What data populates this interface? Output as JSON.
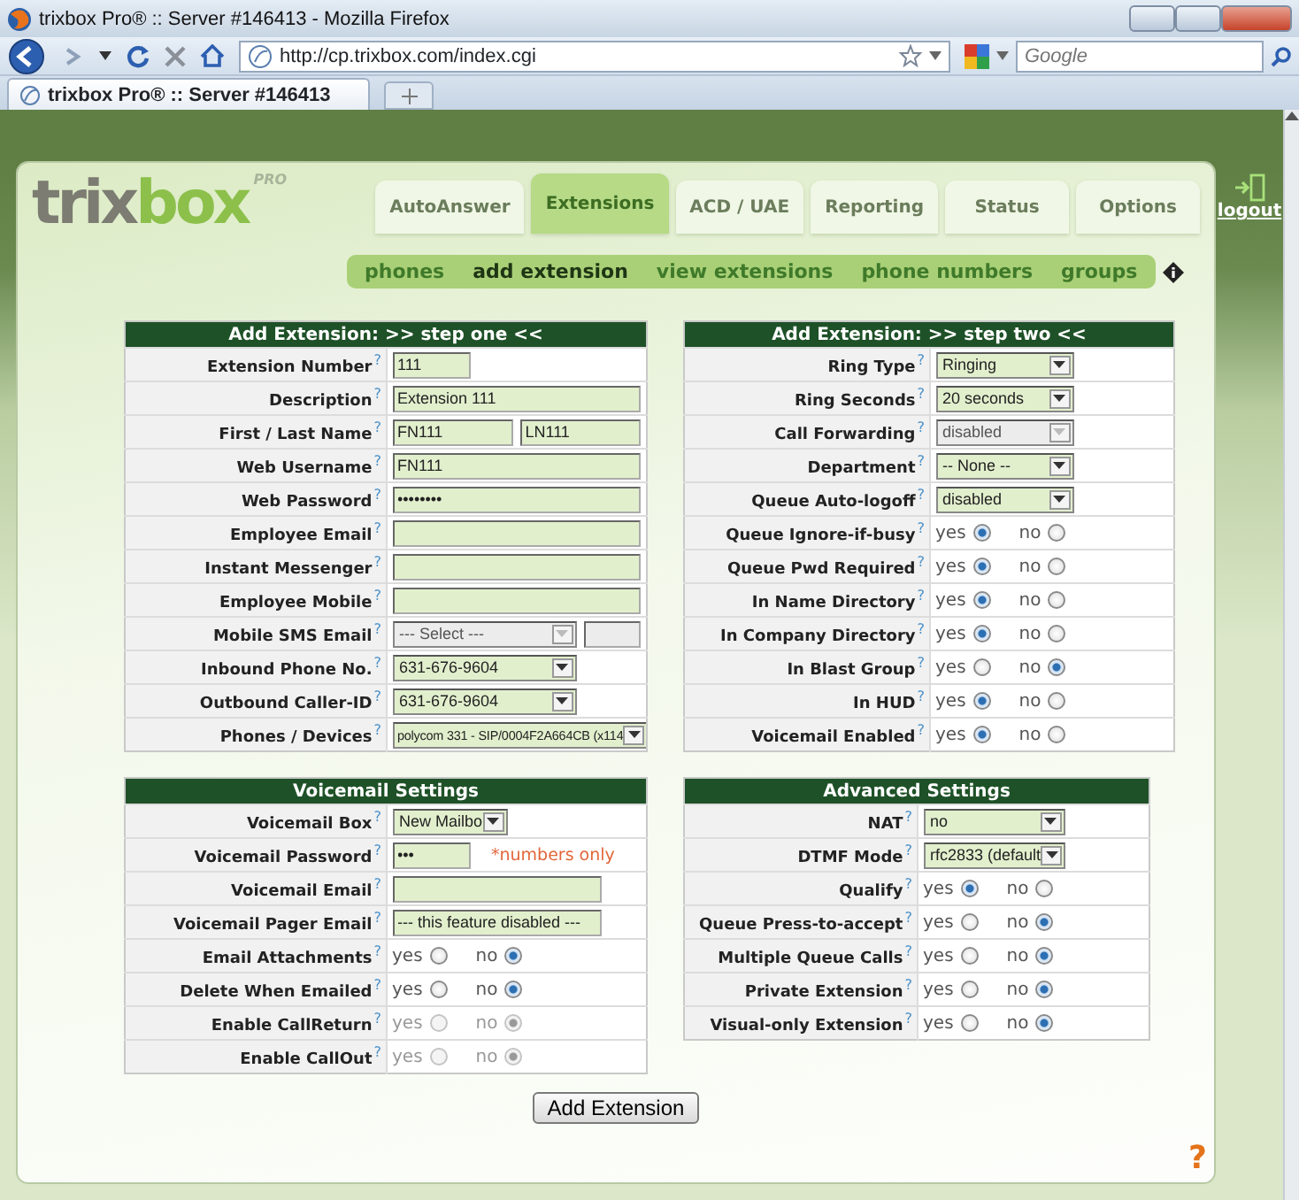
{
  "browser": {
    "title": "trixbox Pro® :: Server #146413 - Mozilla Firefox",
    "url": "http://cp.trixbox.com/index.cgi",
    "search_placeholder": "Google",
    "tabs": [
      {
        "label": "trixbox Pro® :: Server #146413",
        "selected": true
      }
    ]
  },
  "app": {
    "logo": {
      "primary": "trix",
      "accent": "box",
      "tag": "PRO"
    },
    "nav": [
      {
        "label": "AutoAnswer",
        "selected": false
      },
      {
        "label": "Extensions",
        "selected": true
      },
      {
        "label": "ACD / UAE",
        "selected": false
      },
      {
        "label": "Reporting",
        "selected": false
      },
      {
        "label": "Status",
        "selected": false
      },
      {
        "label": "Options",
        "selected": false
      }
    ],
    "subnav": [
      {
        "label": "phones",
        "selected": false
      },
      {
        "label": "add extension",
        "selected": true
      },
      {
        "label": "view extensions",
        "selected": false
      },
      {
        "label": "phone numbers",
        "selected": false
      },
      {
        "label": "groups",
        "selected": false
      }
    ],
    "logout": "logout",
    "panels": [
      {
        "title": "Add Extension: >> step one <<",
        "rows": [
          {
            "label": "Extension Number",
            "help": "?",
            "fields": [
              {
                "kind": "short_input",
                "value": "111"
              }
            ]
          },
          {
            "label": "Description",
            "help": "?",
            "fields": [
              {
                "kind": "input",
                "value": "Extension 111"
              }
            ]
          },
          {
            "label": "First / Last Name",
            "help": "?",
            "fields": [
              {
                "kind": "input",
                "value": "FN111"
              },
              {
                "kind": "input",
                "value": "LN111"
              }
            ]
          },
          {
            "label": "Web Username",
            "help": "?",
            "fields": [
              {
                "kind": "input",
                "value": "FN111"
              }
            ]
          },
          {
            "label": "Web Password",
            "help": "?",
            "fields": [
              {
                "kind": "input",
                "value": "••••••••"
              }
            ]
          },
          {
            "label": "Employee Email",
            "help": "?",
            "fields": [
              {
                "kind": "input"
              }
            ]
          },
          {
            "label": "Instant Messenger",
            "help": "?",
            "fields": [
              {
                "kind": "input"
              }
            ]
          },
          {
            "label": "Employee Mobile",
            "help": "?",
            "fields": [
              {
                "kind": "input"
              }
            ]
          },
          {
            "label": "Mobile SMS Email",
            "help": "?",
            "fields": [
              {
                "kind": "select",
                "value": "--- Select ---",
                "disabled": true
              },
              {
                "kind": "input",
                "disabled": true
              }
            ]
          },
          {
            "label": "Inbound Phone No.",
            "help": "?",
            "fields": [
              {
                "kind": "select",
                "value": "631-676-9604",
                "disabled": false
              }
            ]
          },
          {
            "label": "Outbound Caller-ID",
            "help": "?",
            "fields": [
              {
                "kind": "select",
                "value": "631-676-9604",
                "disabled": false
              }
            ]
          },
          {
            "label": "Phones / Devices",
            "help": "?",
            "fields": [
              {
                "kind": "wide_select",
                "value": "polycom 331 - SIP/0004F2A664CB  (x114",
                "disabled": false
              }
            ]
          }
        ]
      },
      {
        "title": "Add Extension: >> step two <<",
        "rows": [
          {
            "label": "Ring Type",
            "help": "?",
            "fields": [
              {
                "kind": "select",
                "value": "Ringing",
                "disabled": false
              }
            ]
          },
          {
            "label": "Ring Seconds",
            "help": "?",
            "fields": [
              {
                "kind": "select",
                "value": "20 seconds",
                "disabled": false
              }
            ]
          },
          {
            "label": "Call Forwarding",
            "help": "?",
            "fields": [
              {
                "kind": "select",
                "value": "disabled",
                "disabled": true
              }
            ]
          },
          {
            "label": "Department",
            "help": "?",
            "fields": [
              {
                "kind": "select",
                "value": "-- None --",
                "disabled": false
              }
            ]
          },
          {
            "label": "Queue Auto-logoff",
            "help": "?",
            "fields": [
              {
                "kind": "select",
                "value": "disabled",
                "disabled": false
              }
            ]
          },
          {
            "label": "Queue Ignore-if-busy",
            "help": "?",
            "fields": [
              {
                "kind": "radio",
                "options": [
                  {
                    "label": "yes",
                    "selected": true,
                    "disabled": false
                  },
                  {
                    "label": "no",
                    "selected": false,
                    "disabled": false
                  }
                ]
              }
            ]
          },
          {
            "label": "Queue Pwd Required",
            "help": "?",
            "fields": [
              {
                "kind": "radio",
                "options": [
                  {
                    "label": "yes",
                    "selected": true,
                    "disabled": false
                  },
                  {
                    "label": "no",
                    "selected": false,
                    "disabled": false
                  }
                ]
              }
            ]
          },
          {
            "label": "In Name Directory",
            "help": "?",
            "fields": [
              {
                "kind": "radio",
                "options": [
                  {
                    "label": "yes",
                    "selected": true,
                    "disabled": false
                  },
                  {
                    "label": "no",
                    "selected": false,
                    "disabled": false
                  }
                ]
              }
            ]
          },
          {
            "label": "In Company Directory",
            "help": "?",
            "fields": [
              {
                "kind": "radio",
                "options": [
                  {
                    "label": "yes",
                    "selected": true,
                    "disabled": false
                  },
                  {
                    "label": "no",
                    "selected": false,
                    "disabled": false
                  }
                ]
              }
            ]
          },
          {
            "label": "In Blast Group",
            "help": "?",
            "fields": [
              {
                "kind": "radio",
                "options": [
                  {
                    "label": "yes",
                    "selected": false,
                    "disabled": false
                  },
                  {
                    "label": "no",
                    "selected": true,
                    "disabled": false
                  }
                ]
              }
            ]
          },
          {
            "label": "In HUD",
            "help": "?",
            "fields": [
              {
                "kind": "radio",
                "options": [
                  {
                    "label": "yes",
                    "selected": true,
                    "disabled": false
                  },
                  {
                    "label": "no",
                    "selected": false,
                    "disabled": false
                  }
                ]
              }
            ]
          },
          {
            "label": "Voicemail Enabled",
            "help": "?",
            "fields": [
              {
                "kind": "radio",
                "options": [
                  {
                    "label": "yes",
                    "selected": true,
                    "disabled": false
                  },
                  {
                    "label": "no",
                    "selected": false,
                    "disabled": false
                  }
                ]
              }
            ]
          }
        ]
      },
      {
        "title": "Voicemail Settings",
        "rows": [
          {
            "label": "Voicemail Box",
            "help": "?",
            "fields": [
              {
                "kind": "select",
                "value": "New Mailbo",
                "disabled": false
              }
            ]
          },
          {
            "label": "Voicemail Password",
            "help": "?",
            "fields": [
              {
                "kind": "short_input",
                "value": "•••"
              },
              {
                "kind": "note",
                "value": "*numbers only"
              }
            ]
          },
          {
            "label": "Voicemail Email",
            "help": "?",
            "fields": [
              {
                "kind": "input"
              }
            ]
          },
          {
            "label": "Voicemail Pager Email",
            "help": "?",
            "fields": [
              {
                "kind": "input",
                "value": "--- this feature disabled ---"
              }
            ]
          },
          {
            "label": "Email Attachments",
            "help": "?",
            "fields": [
              {
                "kind": "radio",
                "options": [
                  {
                    "label": "yes",
                    "selected": false,
                    "disabled": false
                  },
                  {
                    "label": "no",
                    "selected": true,
                    "disabled": false
                  }
                ]
              }
            ]
          },
          {
            "label": "Delete When Emailed",
            "help": "?",
            "fields": [
              {
                "kind": "radio",
                "options": [
                  {
                    "label": "yes",
                    "selected": false,
                    "disabled": false
                  },
                  {
                    "label": "no",
                    "selected": true,
                    "disabled": false
                  }
                ]
              }
            ]
          },
          {
            "label": "Enable CallReturn",
            "help": "?",
            "fields": [
              {
                "kind": "radio",
                "options": [
                  {
                    "label": "yes",
                    "selected": false,
                    "disabled": true
                  },
                  {
                    "label": "no",
                    "selected": true,
                    "disabled": true
                  }
                ]
              }
            ]
          },
          {
            "label": "Enable CallOut",
            "help": "?",
            "fields": [
              {
                "kind": "radio",
                "options": [
                  {
                    "label": "yes",
                    "selected": false,
                    "disabled": true
                  },
                  {
                    "label": "no",
                    "selected": true,
                    "disabled": true
                  }
                ]
              }
            ]
          }
        ]
      },
      {
        "title": "Advanced Settings",
        "rows": [
          {
            "label": "NAT",
            "help": "?",
            "fields": [
              {
                "kind": "select",
                "value": "no",
                "disabled": false
              }
            ]
          },
          {
            "label": "DTMF Mode",
            "help": "?",
            "fields": [
              {
                "kind": "select",
                "value": "rfc2833 (default",
                "disabled": false
              }
            ]
          },
          {
            "label": "Qualify",
            "help": "?",
            "fields": [
              {
                "kind": "radio",
                "options": [
                  {
                    "label": "yes",
                    "selected": true,
                    "disabled": false
                  },
                  {
                    "label": "no",
                    "selected": false,
                    "disabled": false
                  }
                ]
              }
            ]
          },
          {
            "label": "Queue Press-to-accept",
            "help": "?",
            "fields": [
              {
                "kind": "radio",
                "options": [
                  {
                    "label": "yes",
                    "selected": false,
                    "disabled": false
                  },
                  {
                    "label": "no",
                    "selected": true,
                    "disabled": false
                  }
                ]
              }
            ]
          },
          {
            "label": "Multiple Queue Calls",
            "help": "?",
            "fields": [
              {
                "kind": "radio",
                "options": [
                  {
                    "label": "yes",
                    "selected": false,
                    "disabled": false
                  },
                  {
                    "label": "no",
                    "selected": true,
                    "disabled": false
                  }
                ]
              }
            ]
          },
          {
            "label": "Private Extension",
            "help": "?",
            "fields": [
              {
                "kind": "radio",
                "options": [
                  {
                    "label": "yes",
                    "selected": false,
                    "disabled": false
                  },
                  {
                    "label": "no",
                    "selected": true,
                    "disabled": false
                  }
                ]
              }
            ]
          },
          {
            "label": "Visual-only Extension",
            "help": "?",
            "fields": [
              {
                "kind": "radio",
                "options": [
                  {
                    "label": "yes",
                    "selected": false,
                    "disabled": false
                  },
                  {
                    "label": "no",
                    "selected": true,
                    "disabled": false
                  }
                ]
              }
            ]
          }
        ]
      }
    ],
    "submit": "Add Extension",
    "help_corner": "?"
  }
}
